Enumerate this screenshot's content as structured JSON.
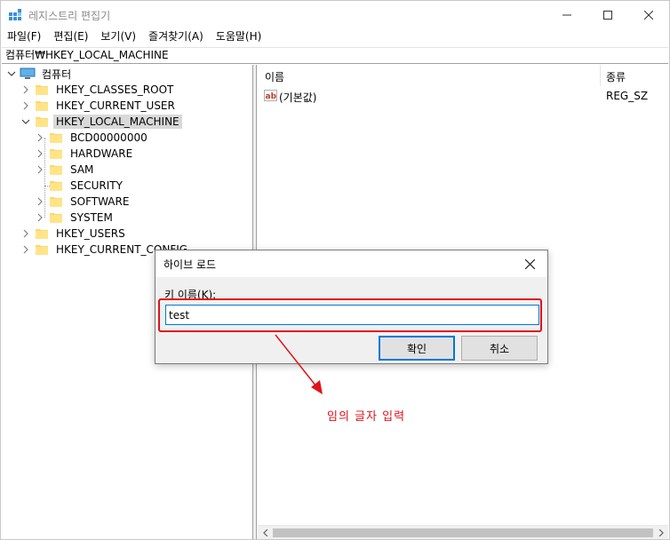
{
  "window": {
    "title": "레지스트리 편집기",
    "accent_color": "#0078d7",
    "annotation_color": "#e0121a"
  },
  "menu": {
    "items": [
      "파일(F)",
      "편집(E)",
      "보기(V)",
      "즐겨찾기(A)",
      "도움말(H)"
    ]
  },
  "address": {
    "path": "컴퓨터₩HKEY_LOCAL_MACHINE"
  },
  "tree": {
    "root": "컴퓨터",
    "hives": {
      "classes_root": "HKEY_CLASSES_ROOT",
      "current_user": "HKEY_CURRENT_USER",
      "local_machine": "HKEY_LOCAL_MACHINE",
      "users": "HKEY_USERS",
      "current_config": "HKEY_CURRENT_CONFIG"
    },
    "local_machine_children": {
      "bcd": "BCD00000000",
      "hardware": "HARDWARE",
      "sam": "SAM",
      "security": "SECURITY",
      "software": "SOFTWARE",
      "system": "SYSTEM"
    }
  },
  "list": {
    "columns": {
      "name": "이름",
      "type": "종류"
    },
    "rows": [
      {
        "name": "(기본값)",
        "type": "REG_SZ",
        "icon": "string-value-icon"
      }
    ]
  },
  "dialog": {
    "title": "하이브 로드",
    "key_label": "키 이름(K):",
    "key_value": "test",
    "ok_label": "확인",
    "cancel_label": "취소"
  },
  "annotation": {
    "text": "임의 글자 입력"
  }
}
